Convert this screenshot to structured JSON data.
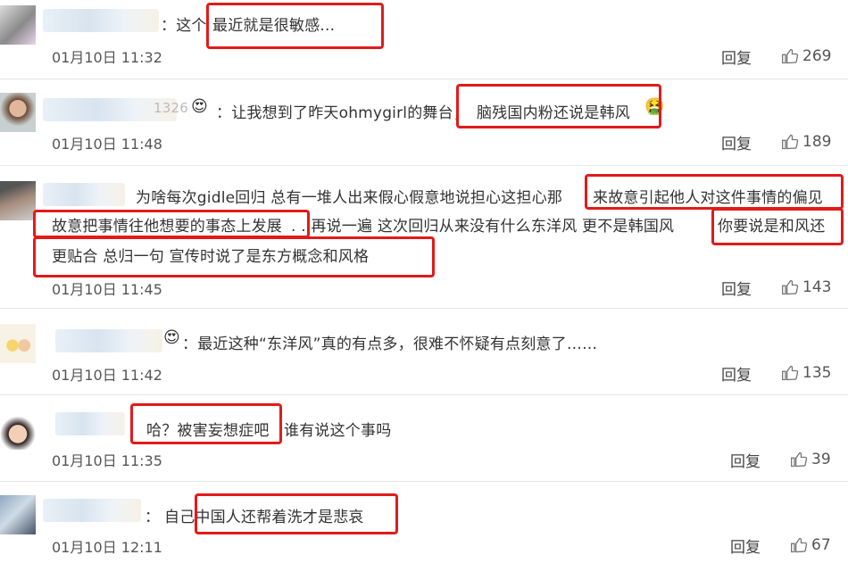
{
  "comments": [
    {
      "text_before": "：这个",
      "text_hl": "最近就是很敏感...",
      "time": "01月10日 11:32",
      "reply": "回复",
      "likes": "269"
    },
    {
      "handle_tail": "1326",
      "text_before": "：让我想到了昨天ohmygirl的舞台，",
      "text_hl": "脑残国内粉还说是韩风",
      "time": "01月10日 11:48",
      "reply": "回复",
      "likes": "189"
    },
    {
      "line1_before": "为啥每次gidle回归 总有一堆人出来假心假意地说担心这担心那",
      "line1_hl": "来故意引起他人对这件事情的偏见",
      "line2_hl": "故意把事情往他想要的事态上发展",
      "line2_mid": ". . 再说一遍 这次回归从来没有什么东洋风 更不是韩国风",
      "line2_hl2": "你要说是和风还",
      "line3_hl": "更贴合 总归一句 宣传时说了是东方概念和风格",
      "time": "01月10日 11:45",
      "reply": "回复",
      "likes": "143"
    },
    {
      "text": "：最近这种“东洋风”真的有点多，很难不怀疑有点刻意了……",
      "time": "01月10日 11:42",
      "reply": "回复",
      "likes": "135"
    },
    {
      "text_hl": "哈？被害妄想症吧",
      "text_after": "谁有说这个事吗",
      "time": "01月10日 11:35",
      "reply": "回复",
      "likes": "39"
    },
    {
      "text_before": "：",
      "text_hl": "自己中国人还帮着洗才是悲哀",
      "time": "01月10日 12:11",
      "reply": "回复",
      "likes": "67"
    }
  ],
  "icons": {
    "like": "thumbs-up-icon",
    "emoji": "heart-eyes-emoji"
  },
  "colors": {
    "highlight": "#e21a1a",
    "divider": "#e6e6e6"
  }
}
